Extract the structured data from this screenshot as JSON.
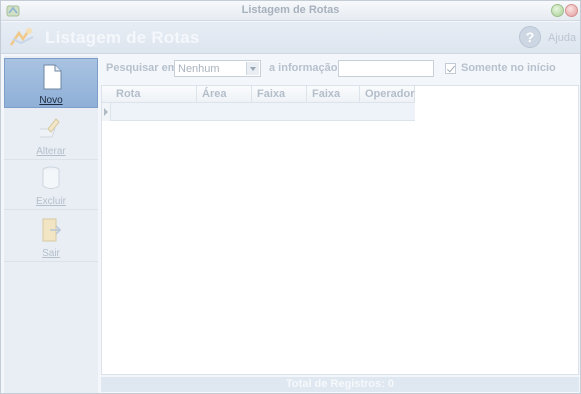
{
  "window": {
    "title": "Listagem de Rotas"
  },
  "header": {
    "heading": "Listagem de Rotas",
    "help_label": "Ajuda",
    "help_glyph": "?"
  },
  "sidebar": {
    "items": [
      {
        "label": "Novo",
        "icon": "new-document-icon",
        "state": "active"
      },
      {
        "label": "Alterar",
        "icon": "edit-icon",
        "state": "disabled"
      },
      {
        "label": "Excluir",
        "icon": "delete-icon",
        "state": "disabled"
      },
      {
        "label": "Sair",
        "icon": "exit-icon",
        "state": "disabled"
      }
    ]
  },
  "search": {
    "field_label": "Pesquisar em",
    "field_value": "Nenhum",
    "info_label": "a informação",
    "info_value": "",
    "only_start_label": "Somente no início",
    "only_start_checked": true
  },
  "grid": {
    "columns": [
      "Rota",
      "Área",
      "Faixa",
      "Faixa",
      "Operador"
    ],
    "rows": []
  },
  "footer": {
    "total_label": "Total de Registros: 0"
  },
  "colors": {
    "active_button": "#9db9dd",
    "disabled_text": "#b5bfcb",
    "row_highlight": "#eef3f9"
  }
}
